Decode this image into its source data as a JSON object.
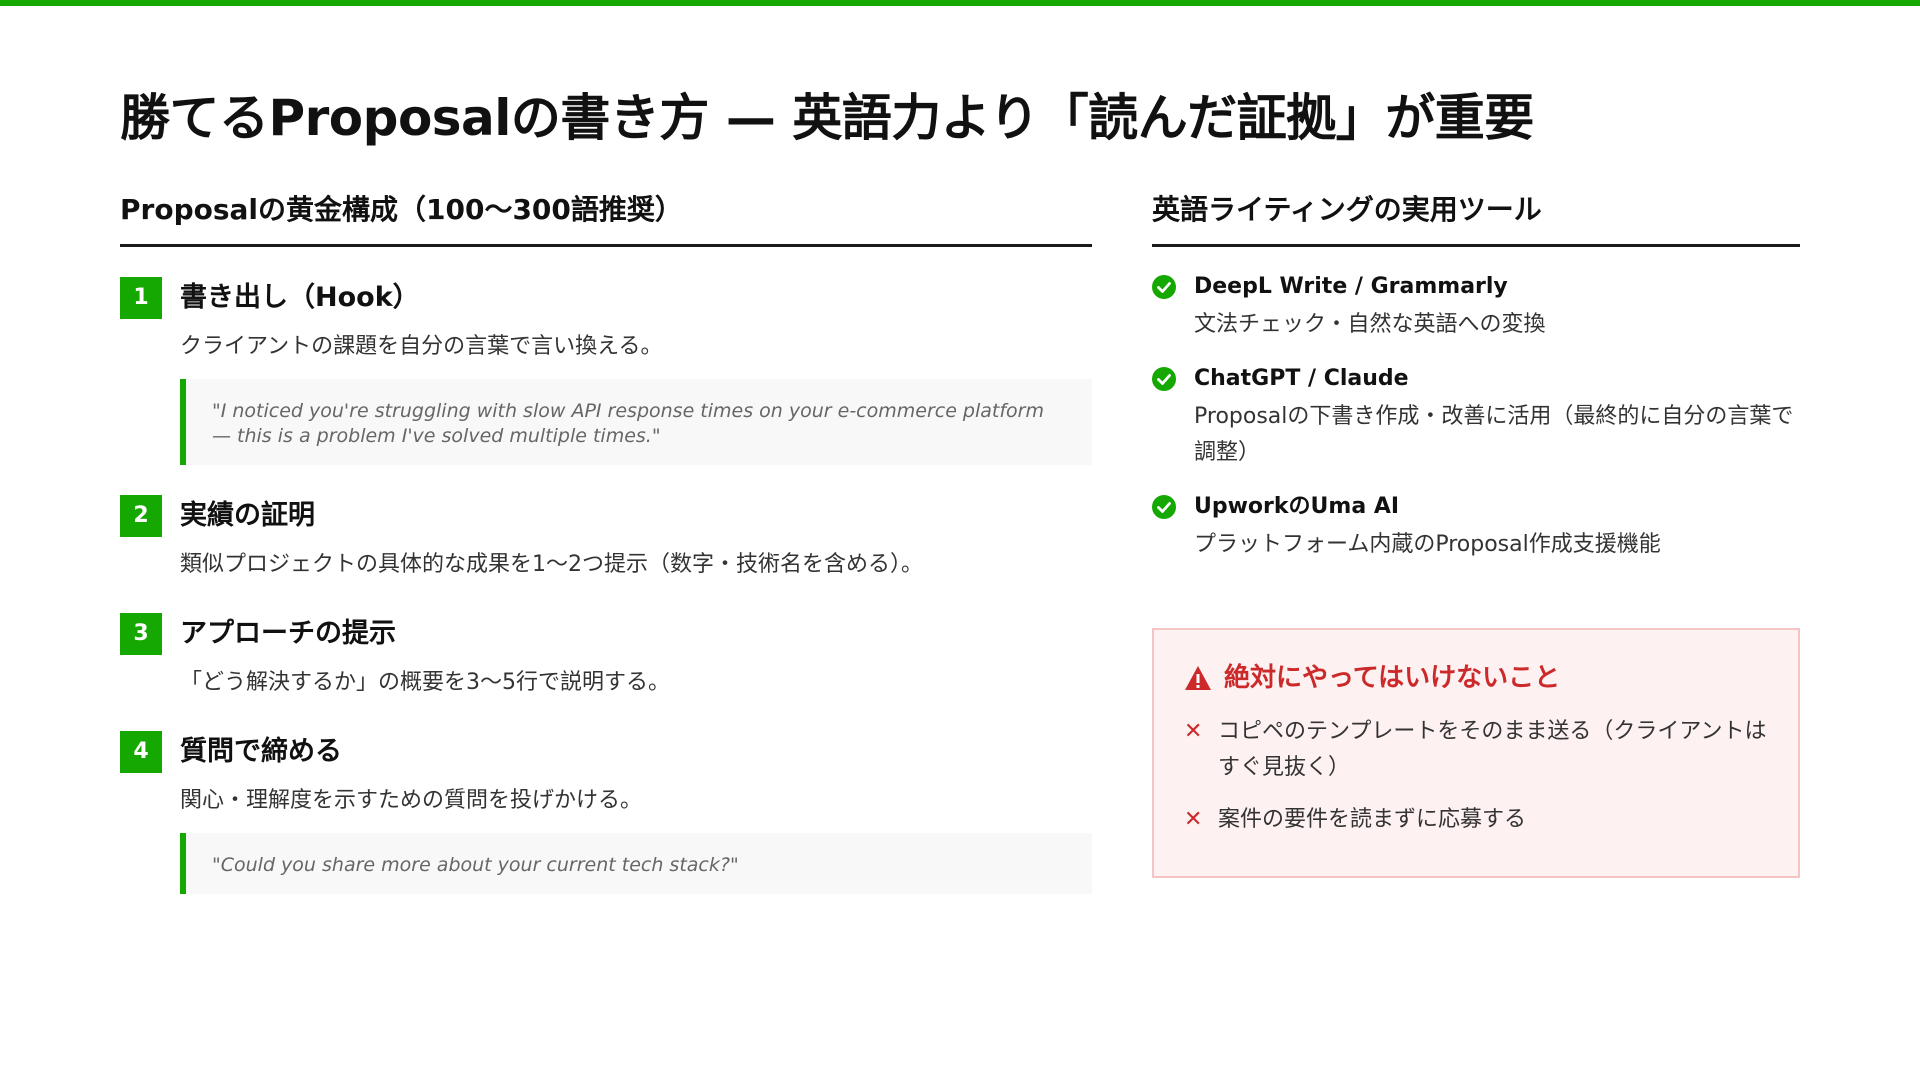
{
  "title": "勝てるProposalの書き方 — 英語力より「読んだ証拠」が重要",
  "left": {
    "heading": "Proposalの黄金構成（100〜300語推奨）",
    "steps": [
      {
        "num": "1",
        "title": "書き出し（Hook）",
        "desc": "クライアントの課題を自分の言葉で言い換える。",
        "quote": "\"I noticed you're struggling with slow API response times on your e-commerce platform — this is a problem I've solved multiple times.\""
      },
      {
        "num": "2",
        "title": "実績の証明",
        "desc": "類似プロジェクトの具体的な成果を1〜2つ提示（数字・技術名を含める）。"
      },
      {
        "num": "3",
        "title": "アプローチの提示",
        "desc": "「どう解決するか」の概要を3〜5行で説明する。"
      },
      {
        "num": "4",
        "title": "質問で締める",
        "desc": "関心・理解度を示すための質問を投げかける。",
        "quote": "\"Could you share more about your current tech stack?\""
      }
    ]
  },
  "right": {
    "heading": "英語ライティングの実用ツール",
    "tools": [
      {
        "name": "DeepL Write / Grammarly",
        "desc": "文法チェック・自然な英語への変換"
      },
      {
        "name": "ChatGPT / Claude",
        "desc": "Proposalの下書き作成・改善に活用（最終的に自分の言葉で調整）"
      },
      {
        "name": "UpworkのUma AI",
        "desc": "プラットフォーム内蔵のProposal作成支援機能"
      }
    ],
    "warning": {
      "title": "絶対にやってはいけないこと",
      "items": [
        "コピペのテンプレートをそのまま送る（クライアントはすぐ見抜く）",
        "案件の要件を読まずに応募する"
      ]
    }
  },
  "colors": {
    "accent": "#14a800",
    "warning": "#cc2a2a",
    "warning_bg": "#fdf1f1"
  },
  "icons": {
    "tool_bullet": "check-circle-icon",
    "warning_title": "warning-triangle-icon",
    "warning_bullet": "x-icon"
  }
}
